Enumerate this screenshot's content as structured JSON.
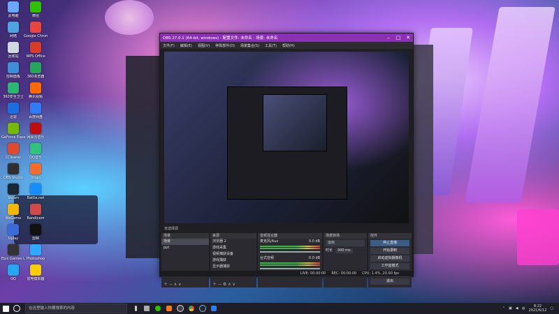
{
  "desktop": {
    "icons": [
      {
        "label": "此电脑",
        "color": "#6aa7ff"
      },
      {
        "label": "网络",
        "color": "#4fa3e0"
      },
      {
        "label": "回收站",
        "color": "#cfd8e3"
      },
      {
        "label": "控制面板",
        "color": "#3f8fd8"
      },
      {
        "label": "360安全卫士",
        "color": "#2bb673"
      },
      {
        "label": "迅雷",
        "color": "#1d6fe0"
      },
      {
        "label": "GeForce Experience",
        "color": "#76b900"
      },
      {
        "label": "CCleaner",
        "color": "#e04a2b"
      },
      {
        "label": "OBS Studio",
        "color": "#302e31"
      },
      {
        "label": "Steam",
        "color": "#1b2838"
      },
      {
        "label": "WeGame",
        "color": "#f2b705"
      },
      {
        "label": "Uplay",
        "color": "#3a6bd8"
      },
      {
        "label": "Epic Games Launcher",
        "color": "#333333"
      },
      {
        "label": "QQ",
        "color": "#22a7f0"
      },
      {
        "label": "微信",
        "color": "#2dc100"
      },
      {
        "label": "Google Chrome",
        "color": "#e8453c"
      },
      {
        "label": "WPS Office",
        "color": "#d93b2b"
      },
      {
        "label": "360浏览器",
        "color": "#26a65b"
      },
      {
        "label": "腾讯视频",
        "color": "#ff6a00"
      },
      {
        "label": "百度网盘",
        "color": "#2f7cf6"
      },
      {
        "label": "网易云音乐",
        "color": "#c20c0c"
      },
      {
        "label": "QQ音乐",
        "color": "#31c27c"
      },
      {
        "label": "Origin",
        "color": "#f56c2d"
      },
      {
        "label": "Battle.net",
        "color": "#148eff"
      },
      {
        "label": "Bandicam",
        "color": "#d04a4a"
      },
      {
        "label": "剪映",
        "color": "#111111"
      },
      {
        "label": "Photoshop",
        "color": "#31a8ff"
      },
      {
        "label": "雷电模拟器",
        "color": "#ffcc00"
      }
    ]
  },
  "obs": {
    "title": "OBS 27.0.1 (64-bit, windows) - 配置文件: 未命名 - 场景: 未命名",
    "menu": [
      "文件(F)",
      "编辑(E)",
      "视图(V)",
      "停靠部件(D)",
      "场景集合(S)",
      "工具(T)",
      "帮助(H)"
    ],
    "controls": {
      "minimize": "–",
      "maximize": "□",
      "close": "✕"
    },
    "scene_bar": "未选择源",
    "docks": {
      "scenes": {
        "header": "场景",
        "items": [
          "场景",
          "ppt"
        ]
      },
      "sources": {
        "header": "来源",
        "items": [
          "浏览器 2",
          "游戏采集",
          "视频捕获设备",
          "游戏捕获",
          "显示器捕获"
        ]
      },
      "mixer": {
        "header": "音频混合器",
        "channels": [
          {
            "name": "麦克风/Aux",
            "level": "0.0 dB"
          },
          {
            "name": "台式音频",
            "level": "0.0 dB"
          }
        ]
      },
      "transitions": {
        "header": "场景转场",
        "type": "淡出",
        "duration_label": "时长",
        "duration": "300 ms"
      },
      "controls": {
        "header": "控件",
        "buttons": [
          "停止直播",
          "开始录制",
          "启动虚拟摄像机",
          "工作室模式",
          "设置",
          "退出"
        ]
      }
    },
    "status": {
      "live": "LIVE: 00:00:00",
      "rec": "REC: 00:00:00",
      "cpu": "CPU: 1.4%, 20.00 fps"
    }
  },
  "taskbar": {
    "search_placeholder": "在这里输入你要搜索的内容",
    "time": "8:22",
    "date": "2021/6/12",
    "ime": "中"
  }
}
